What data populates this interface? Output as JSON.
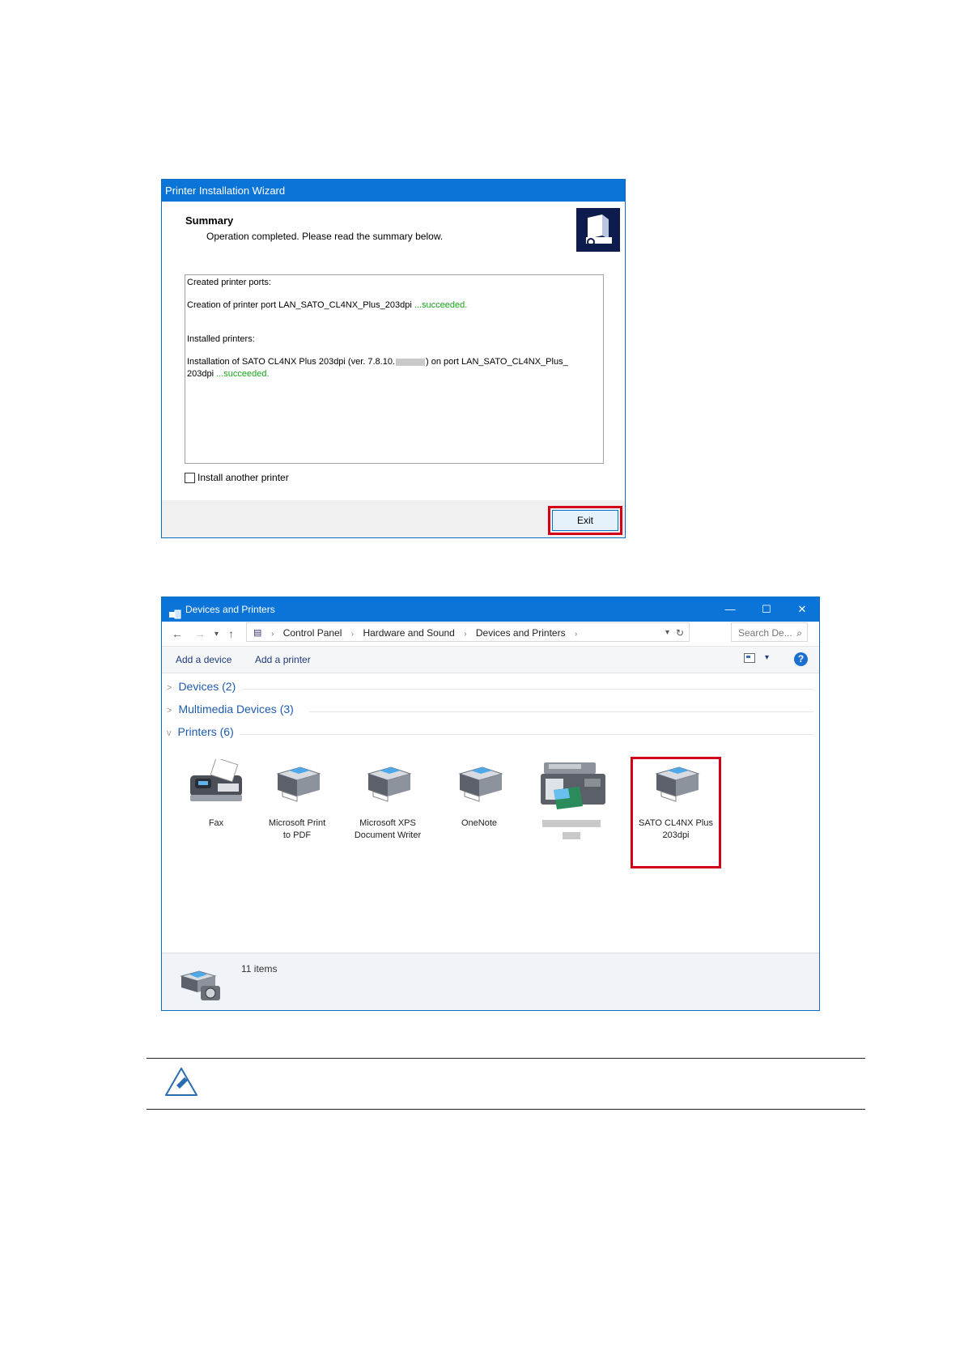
{
  "wizard": {
    "title": "Printer Installation Wizard",
    "summary_title": "Summary",
    "summary_subtitle": "Operation completed. Please read the summary below.",
    "log": {
      "created_ports_header": "Created printer ports:",
      "port_line_prefix": "Creation of printer port LAN_SATO_CL4NX_Plus_203dpi",
      "port_line_status": " ...succeeded.",
      "installed_header": "Installed printers:",
      "install_line_a": "Installation of SATO CL4NX Plus 203dpi (ver. 7.8.10.",
      "install_line_b": ") on port LAN_SATO_CL4NX_Plus_",
      "install_line_c": "203dpi",
      "install_line_status": " ...succeeded."
    },
    "checkbox_label": "Install another printer",
    "exit_label": "Exit"
  },
  "devices_window": {
    "title": "Devices and Printers",
    "window_buttons": {
      "minimize": "—",
      "maximize": "☐",
      "close": "✕"
    },
    "breadcrumb": [
      "Control Panel",
      "Hardware and Sound",
      "Devices and Printers"
    ],
    "search_placeholder": "Search De...",
    "commands": {
      "add_device": "Add a device",
      "add_printer": "Add a printer",
      "help": "?"
    },
    "groups": {
      "devices": "Devices (2)",
      "multimedia": "Multimedia Devices (3)",
      "printers": "Printers (6)"
    },
    "printers": [
      {
        "line1": "Fax",
        "line2": "",
        "icon": "fax-icon"
      },
      {
        "line1": "Microsoft Print",
        "line2": "to PDF",
        "icon": "printer-icon"
      },
      {
        "line1": "Microsoft XPS",
        "line2": "Document Writer",
        "icon": "printer-icon"
      },
      {
        "line1": "OneNote",
        "line2": "",
        "icon": "printer-icon"
      },
      {
        "line1": "",
        "line2": "",
        "icon": "multifunction-printer-icon"
      },
      {
        "line1": "SATO CL4NX Plus",
        "line2": "203dpi",
        "icon": "printer-icon"
      }
    ],
    "status": {
      "count": "11 items"
    }
  },
  "colors": {
    "accent": "#0a74d8",
    "highlight": "#d4001a",
    "success": "#1aa31a",
    "link": "#1e5ab0"
  }
}
